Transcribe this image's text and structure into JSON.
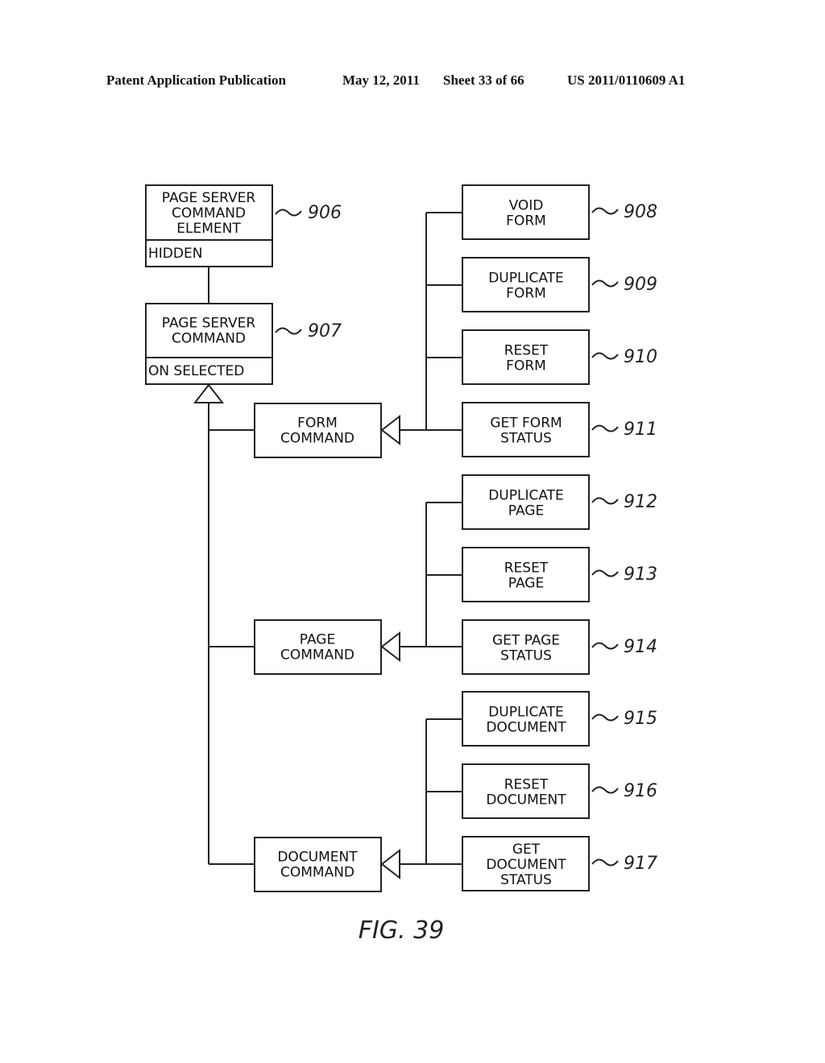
{
  "header": {
    "publication": "Patent Application Publication",
    "date": "May 12, 2011",
    "sheet": "Sheet 33 of 66",
    "number": "US 2011/0110609 A1"
  },
  "figure_label": "FIG. 39",
  "classes": {
    "element": {
      "lines": [
        "PAGE SERVER",
        "COMMAND",
        "ELEMENT"
      ],
      "attribute": "HIDDEN",
      "ref": "906"
    },
    "command": {
      "lines": [
        "PAGE SERVER",
        "COMMAND"
      ],
      "attribute": "ON SELECTED",
      "ref": "907"
    }
  },
  "subclasses": [
    {
      "id": "form",
      "lines": [
        "FORM",
        "COMMAND"
      ],
      "children": [
        {
          "lines": [
            "VOID",
            "FORM"
          ],
          "ref": "908"
        },
        {
          "lines": [
            "DUPLICATE",
            "FORM"
          ],
          "ref": "909"
        },
        {
          "lines": [
            "RESET",
            "FORM"
          ],
          "ref": "910"
        },
        {
          "lines": [
            "GET FORM",
            "STATUS"
          ],
          "ref": "911"
        }
      ]
    },
    {
      "id": "page",
      "lines": [
        "PAGE",
        "COMMAND"
      ],
      "children": [
        {
          "lines": [
            "DUPLICATE",
            "PAGE"
          ],
          "ref": "912"
        },
        {
          "lines": [
            "RESET",
            "PAGE"
          ],
          "ref": "913"
        },
        {
          "lines": [
            "GET PAGE",
            "STATUS"
          ],
          "ref": "914"
        }
      ]
    },
    {
      "id": "document",
      "lines": [
        "DOCUMENT",
        "COMMAND"
      ],
      "children": [
        {
          "lines": [
            "DUPLICATE",
            "DOCUMENT"
          ],
          "ref": "915"
        },
        {
          "lines": [
            "RESET",
            "DOCUMENT"
          ],
          "ref": "916"
        },
        {
          "lines": [
            "GET",
            "DOCUMENT",
            "STATUS"
          ],
          "ref": "917"
        }
      ]
    }
  ]
}
